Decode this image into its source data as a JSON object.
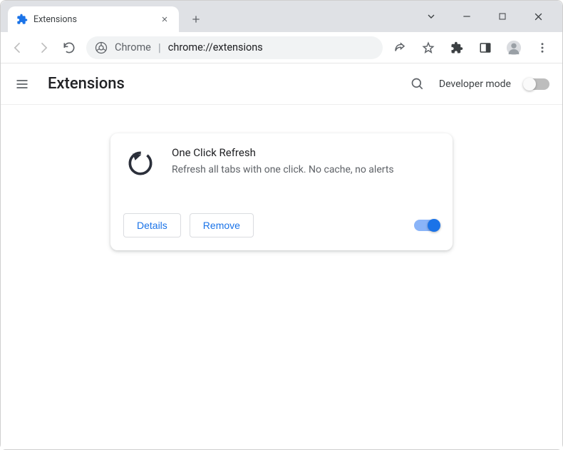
{
  "tab": {
    "title": "Extensions"
  },
  "omnibox": {
    "prefix": "Chrome",
    "path": "chrome://extensions"
  },
  "header": {
    "title": "Extensions",
    "developer_mode_label": "Developer mode"
  },
  "extension_card": {
    "name": "One Click Refresh",
    "description": "Refresh all tabs with one click. No cache, no alerts",
    "details_label": "Details",
    "remove_label": "Remove"
  }
}
